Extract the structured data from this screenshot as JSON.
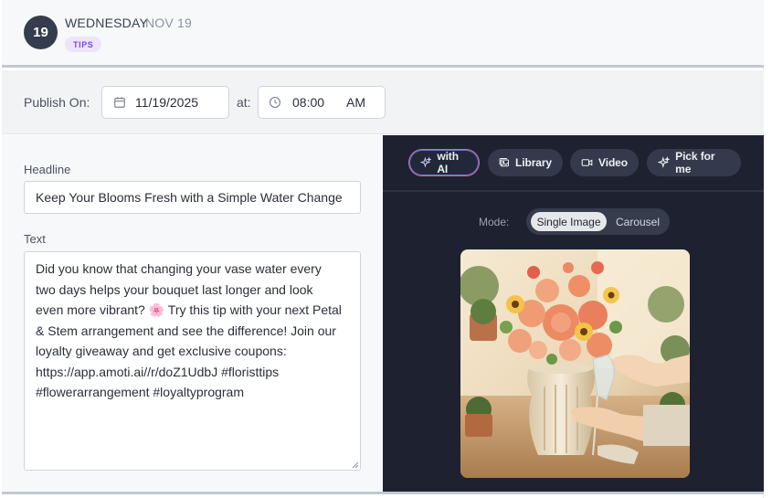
{
  "header": {
    "day_number": "19",
    "day_name": "WEDNESDAY",
    "date": "NOV 19",
    "tag": "TIPS"
  },
  "publish": {
    "label": "Publish On:",
    "date_value": "11/19/2025",
    "at_label": "at:",
    "time_value": "08:00",
    "ampm": "AM",
    "date_icon": "calendar-icon",
    "time_icon": "clock-icon"
  },
  "post": {
    "headline_label": "Headline",
    "headline_value": "Keep Your Blooms Fresh with a Simple Water Change",
    "text_label": "Text",
    "text_value": "Did you know that changing your vase water every\ntwo days helps your bouquet last longer and look\neven more vibrant? 🌸 Try this tip with your next Petal\n& Stem arrangement and see the difference! Join our\nloyalty giveaway and get exclusive coupons:\nhttps://app.amoti.ai//r/doZ1UdbJ #floristtips\n#flowerarrangement #loyaltyprogram"
  },
  "media": {
    "buttons": [
      {
        "label": "with AI",
        "icon": "sparkle-icon"
      },
      {
        "label": "Library",
        "icon": "image-icon"
      },
      {
        "label": "Video",
        "icon": "video-icon"
      },
      {
        "label": "Pick for me",
        "icon": "sparkle-icon"
      }
    ],
    "mode_label": "Mode:",
    "mode_options": [
      "Single Image",
      "Carousel"
    ],
    "mode_selected": "Single Image"
  },
  "colors": {
    "day_badge": "#353c4d",
    "tag_bg": "#ede4fb",
    "tag_text": "#7c4ad8",
    "media_panel_bg": "#1e2230",
    "ai_button_border": "#c56aa8"
  }
}
